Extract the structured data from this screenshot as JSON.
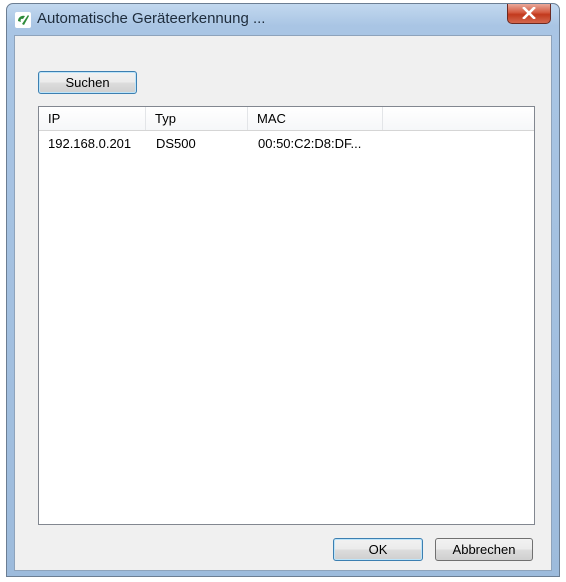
{
  "window": {
    "title": "Automatische Geräteerkennung ...",
    "icon": "app-logo-icon",
    "close_icon": "close-icon"
  },
  "toolbar": {
    "search_label": "Suchen"
  },
  "device_list": {
    "columns": [
      "IP",
      "Typ",
      "MAC",
      ""
    ],
    "rows": [
      {
        "ip": "192.168.0.201",
        "type": "DS500",
        "mac": "00:50:C2:D8:DF..."
      }
    ]
  },
  "footer": {
    "ok_label": "OK",
    "cancel_label": "Abbrechen"
  },
  "colors": {
    "titlebar": "#a9c5e4",
    "client": "#f0f0f0",
    "close": "#c2391d",
    "logo": "#2e8b3a"
  }
}
